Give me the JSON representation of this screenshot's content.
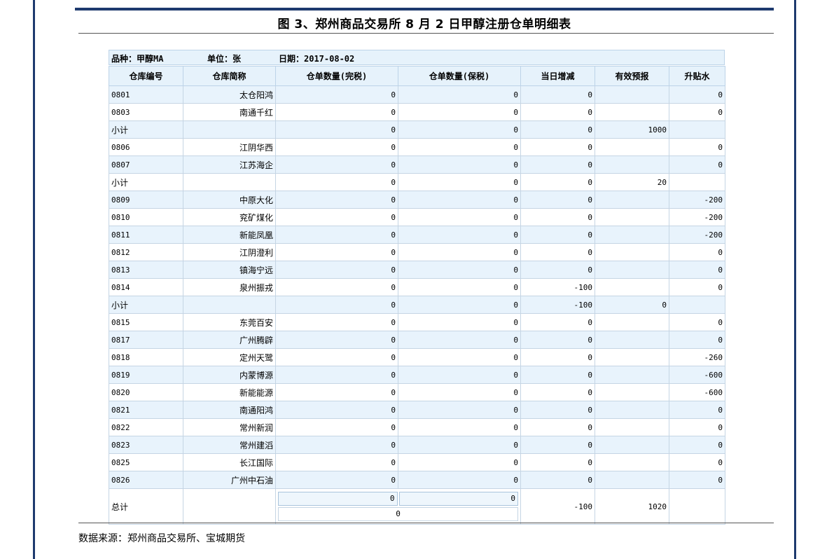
{
  "title": "图 3、郑州商品交易所 8 月 2 日甲醇注册仓单明细表",
  "meta": {
    "variety": "品种：甲醇MA",
    "unit": "单位：张",
    "date": "日期：2017-08-02"
  },
  "columns": [
    "仓库编号",
    "仓库简称",
    "仓单数量(完税)",
    "仓单数量(保税)",
    "当日增减",
    "有效预报",
    "升贴水"
  ],
  "rows": [
    {
      "code": "0801",
      "name": "太仓阳鸿",
      "tax": "0",
      "bonded": "0",
      "change": "0",
      "forecast": "",
      "premium": "0",
      "alt": true
    },
    {
      "code": "0803",
      "name": "南通千红",
      "tax": "0",
      "bonded": "0",
      "change": "0",
      "forecast": "",
      "premium": "0",
      "alt": false
    },
    {
      "code": "小计",
      "name": "",
      "tax": "0",
      "bonded": "0",
      "change": "0",
      "forecast": "1000",
      "premium": "",
      "alt": true,
      "sub": true
    },
    {
      "code": "0806",
      "name": "江阴华西",
      "tax": "0",
      "bonded": "0",
      "change": "0",
      "forecast": "",
      "premium": "0",
      "alt": false
    },
    {
      "code": "0807",
      "name": "江苏海企",
      "tax": "0",
      "bonded": "0",
      "change": "0",
      "forecast": "",
      "premium": "0",
      "alt": true
    },
    {
      "code": "小计",
      "name": "",
      "tax": "0",
      "bonded": "0",
      "change": "0",
      "forecast": "20",
      "premium": "",
      "alt": false,
      "sub": true
    },
    {
      "code": "0809",
      "name": "中原大化",
      "tax": "0",
      "bonded": "0",
      "change": "0",
      "forecast": "",
      "premium": "-200",
      "alt": true
    },
    {
      "code": "0810",
      "name": "兖矿煤化",
      "tax": "0",
      "bonded": "0",
      "change": "0",
      "forecast": "",
      "premium": "-200",
      "alt": false
    },
    {
      "code": "0811",
      "name": "新能凤凰",
      "tax": "0",
      "bonded": "0",
      "change": "0",
      "forecast": "",
      "premium": "-200",
      "alt": true
    },
    {
      "code": "0812",
      "name": "江阴澄利",
      "tax": "0",
      "bonded": "0",
      "change": "0",
      "forecast": "",
      "premium": "0",
      "alt": false
    },
    {
      "code": "0813",
      "name": "镇海宁远",
      "tax": "0",
      "bonded": "0",
      "change": "0",
      "forecast": "",
      "premium": "0",
      "alt": true
    },
    {
      "code": "0814",
      "name": "泉州振戎",
      "tax": "0",
      "bonded": "0",
      "change": "-100",
      "forecast": "",
      "premium": "0",
      "alt": false
    },
    {
      "code": "小计",
      "name": "",
      "tax": "0",
      "bonded": "0",
      "change": "-100",
      "forecast": "0",
      "premium": "",
      "alt": true,
      "sub": true
    },
    {
      "code": "0815",
      "name": "东莞百安",
      "tax": "0",
      "bonded": "0",
      "change": "0",
      "forecast": "",
      "premium": "0",
      "alt": false
    },
    {
      "code": "0817",
      "name": "广州腾辟",
      "tax": "0",
      "bonded": "0",
      "change": "0",
      "forecast": "",
      "premium": "0",
      "alt": true
    },
    {
      "code": "0818",
      "name": "定州天鹭",
      "tax": "0",
      "bonded": "0",
      "change": "0",
      "forecast": "",
      "premium": "-260",
      "alt": false
    },
    {
      "code": "0819",
      "name": "内蒙博源",
      "tax": "0",
      "bonded": "0",
      "change": "0",
      "forecast": "",
      "premium": "-600",
      "alt": true
    },
    {
      "code": "0820",
      "name": "新能能源",
      "tax": "0",
      "bonded": "0",
      "change": "0",
      "forecast": "",
      "premium": "-600",
      "alt": false
    },
    {
      "code": "0821",
      "name": "南通阳鸿",
      "tax": "0",
      "bonded": "0",
      "change": "0",
      "forecast": "",
      "premium": "0",
      "alt": true
    },
    {
      "code": "0822",
      "name": "常州新润",
      "tax": "0",
      "bonded": "0",
      "change": "0",
      "forecast": "",
      "premium": "0",
      "alt": false
    },
    {
      "code": "0823",
      "name": "常州建滔",
      "tax": "0",
      "bonded": "0",
      "change": "0",
      "forecast": "",
      "premium": "0",
      "alt": true
    },
    {
      "code": "0825",
      "name": "长江国际",
      "tax": "0",
      "bonded": "0",
      "change": "0",
      "forecast": "",
      "premium": "0",
      "alt": false
    },
    {
      "code": "0826",
      "name": "广州中石油",
      "tax": "0",
      "bonded": "0",
      "change": "0",
      "forecast": "",
      "premium": "0",
      "alt": true
    }
  ],
  "total": {
    "label": "总计",
    "tax": "0",
    "bonded": "0",
    "combined": "0",
    "change": "-100",
    "forecast": "1020",
    "premium": ""
  },
  "source": "数据来源：郑州商品交易所、宝城期货"
}
